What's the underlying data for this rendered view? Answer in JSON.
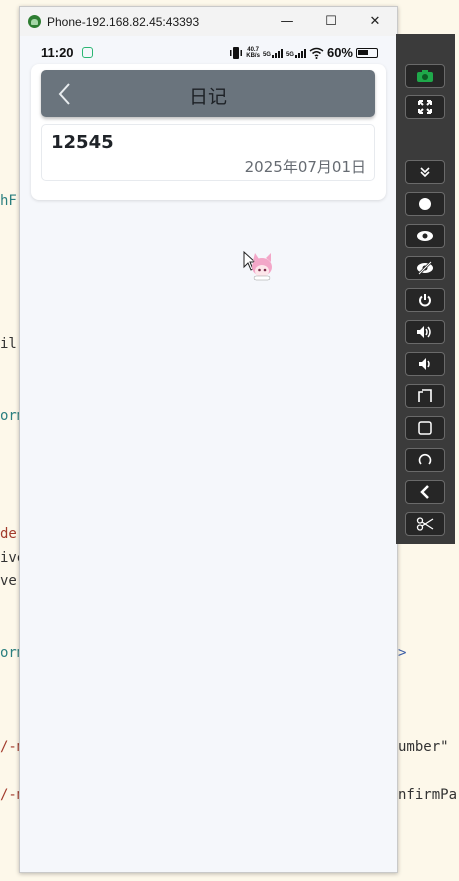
{
  "window": {
    "title": "Phone-192.168.82.45:43393",
    "minimize": "—",
    "maximize": "☐",
    "close": "✕"
  },
  "status_bar": {
    "time": "11:20",
    "net_speed_value": "40.7",
    "net_speed_unit": "KB/s",
    "sim1": "5G",
    "sim2": "5G",
    "battery": "60%"
  },
  "header": {
    "title": "日记"
  },
  "entries": [
    {
      "title": "12545",
      "date": "2025年07月01日"
    }
  ],
  "background_code": [
    {
      "text": "hF"
    },
    {
      "text": "il"
    },
    {
      "text": "orm"
    },
    {
      "text": "de"
    },
    {
      "text": "ive"
    },
    {
      "text": "ve'"
    },
    {
      "text": "orm"
    },
    {
      "text": "/-m"
    },
    {
      "text": "/-m"
    },
    {
      "text": "umber\""
    },
    {
      "text": "nfirmPa"
    },
    {
      "text": ">"
    }
  ],
  "toolbar": {
    "buttons": [
      "screenshot-icon",
      "fullscreen-icon",
      "expand-down-icon",
      "record-icon",
      "show-icon",
      "hide-icon",
      "power-icon",
      "volume-up-icon",
      "volume-down-icon",
      "rotate-icon",
      "home-icon",
      "recents-icon",
      "back-icon",
      "cut-icon"
    ]
  },
  "colors": {
    "header_bar": "#6a747d",
    "screen_bg": "#f5f7fb",
    "toolbar_bg": "#3b3b3b",
    "accent_green": "#2e7d32"
  }
}
